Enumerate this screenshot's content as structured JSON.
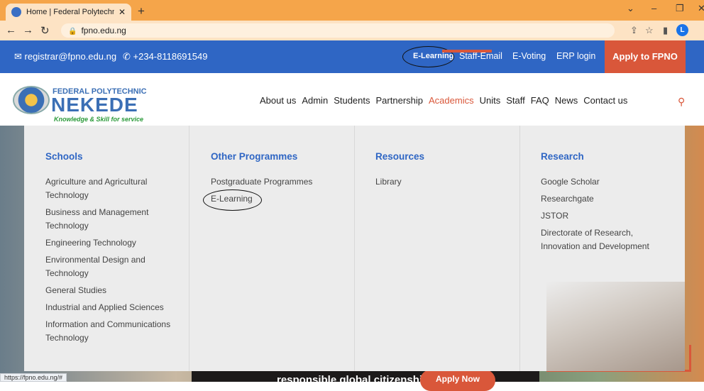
{
  "browser": {
    "tab_title": "Home | Federal Polytechnic Neke",
    "new_tab": "+",
    "url": "fpno.edu.ng",
    "avatar_letter": "L",
    "status_url": "https://fpno.edu.ng/#"
  },
  "topbar": {
    "email": "registrar@fpno.edu.ng",
    "phone": "+234-8118691549",
    "links": [
      "E-Learning",
      "Staff-Email",
      "E-Voting",
      "ERP login"
    ],
    "apply": "Apply to FPNO"
  },
  "logo": {
    "line1": "FEDERAL POLYTECHNIC",
    "line2": "NEKEDE",
    "tagline": "Knowledge & Skill for service"
  },
  "nav": {
    "items": [
      "About us",
      "Admin",
      "Students",
      "Partnership",
      "Academics",
      "Units",
      "Staff",
      "FAQ",
      "News",
      "Contact us"
    ],
    "active": "Academics"
  },
  "mega": {
    "columns": [
      {
        "title": "Schools",
        "items": [
          "Agriculture and Agricultural Technology",
          "Business and Management Technology",
          "Engineering Technology",
          "Environmental Design and Technology",
          "General Studies",
          "Industrial and Applied Sciences",
          "Information and Communications Technology"
        ]
      },
      {
        "title": "Other Programmes",
        "items": [
          "Postgraduate Programmes",
          "E-Learning"
        ]
      },
      {
        "title": "Resources",
        "items": [
          "Library"
        ]
      },
      {
        "title": "Research",
        "items": [
          "Google Scholar",
          "Researchgate",
          "JSTOR",
          "Directorate of Research, Innovation and Development"
        ]
      }
    ]
  },
  "background": {
    "banner_text": "responsible global citizenship",
    "banner_button": "Apply Now"
  },
  "colors": {
    "brand_blue": "#2f66c4",
    "accent_orange": "#d9573a"
  }
}
